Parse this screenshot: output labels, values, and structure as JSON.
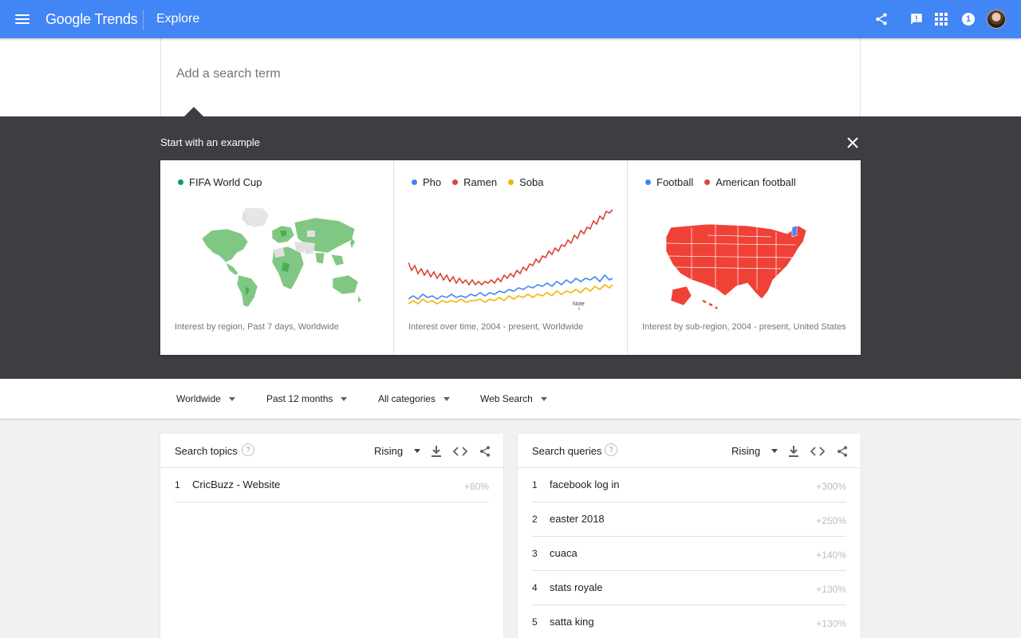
{
  "topbar": {
    "brand": "Google Trends",
    "page": "Explore",
    "notification_count": "1"
  },
  "search": {
    "placeholder": "Add a search term"
  },
  "examples": {
    "title": "Start with an example",
    "cards": [
      {
        "legend": [
          {
            "label": "FIFA World Cup",
            "color": "#0f9d58"
          }
        ],
        "caption": "Interest by region, Past 7 days, Worldwide"
      },
      {
        "legend": [
          {
            "label": "Pho",
            "color": "#4285f4"
          },
          {
            "label": "Ramen",
            "color": "#db4437"
          },
          {
            "label": "Soba",
            "color": "#f4b400"
          }
        ],
        "caption": "Interest over time, 2004 - present, Worldwide",
        "note": "Note"
      },
      {
        "legend": [
          {
            "label": "Football",
            "color": "#4285f4"
          },
          {
            "label": "American football",
            "color": "#db4437"
          }
        ],
        "caption": "Interest by sub-region, 2004 - present, United States"
      }
    ]
  },
  "filters": {
    "region": "Worldwide",
    "time": "Past 12 months",
    "category": "All categories",
    "property": "Web Search"
  },
  "topics": {
    "title": "Search topics",
    "sort": "Rising",
    "rows": [
      {
        "index": "1",
        "label": "CricBuzz - Website",
        "value": "+80%"
      }
    ]
  },
  "queries": {
    "title": "Search queries",
    "sort": "Rising",
    "rows": [
      {
        "index": "1",
        "label": "facebook log in",
        "value": "+300%"
      },
      {
        "index": "2",
        "label": "easter 2018",
        "value": "+250%"
      },
      {
        "index": "3",
        "label": "cuaca",
        "value": "+140%"
      },
      {
        "index": "4",
        "label": "stats royale",
        "value": "+130%"
      },
      {
        "index": "5",
        "label": "satta king",
        "value": "+130%"
      }
    ]
  },
  "colors": {
    "header": "#4285f4",
    "dark_panel": "#3c3e42",
    "map_green": "#81c784",
    "map_red": "#ef4136"
  }
}
